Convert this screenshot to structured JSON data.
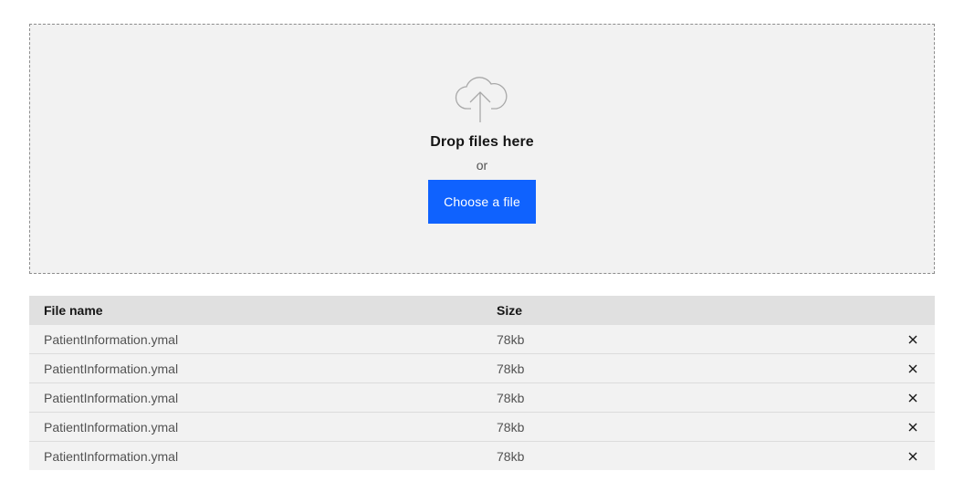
{
  "dropzone": {
    "icon": "cloud-upload-icon",
    "title": "Drop files here",
    "separator": "or",
    "button_label": "Choose a file"
  },
  "table": {
    "headers": {
      "file_name": "File name",
      "size": "Size"
    },
    "rows": [
      {
        "name": "PatientInformation.ymal",
        "size": "78kb",
        "action_icon": "close-icon"
      },
      {
        "name": "PatientInformation.ymal",
        "size": "78kb",
        "action_icon": "close-icon"
      },
      {
        "name": "PatientInformation.ymal",
        "size": "78kb",
        "action_icon": "close-icon"
      },
      {
        "name": "PatientInformation.ymal",
        "size": "78kb",
        "action_icon": "close-icon"
      },
      {
        "name": "PatientInformation.ymal",
        "size": "78kb",
        "action_icon": "close-icon"
      }
    ]
  },
  "colors": {
    "primary": "#0f62fe",
    "background": "#f2f2f2",
    "header": "#e0e0e0"
  }
}
